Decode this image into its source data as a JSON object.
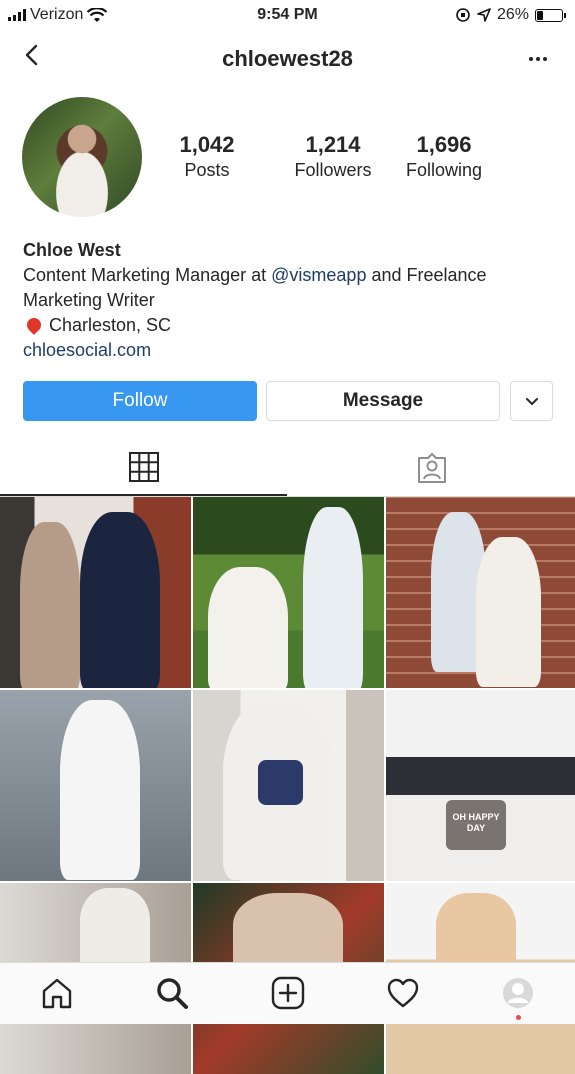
{
  "status_bar": {
    "carrier": "Verizon",
    "time": "9:54 PM",
    "battery": "26%",
    "battery_level": 0.26
  },
  "header": {
    "username": "chloewest28",
    "back_icon": "chevron-left-icon",
    "more_icon": "more-dots-icon"
  },
  "profile": {
    "stats": [
      {
        "value": "1,042",
        "label": "Posts"
      },
      {
        "value": "1,214",
        "label": "Followers"
      },
      {
        "value": "1,696",
        "label": "Following"
      }
    ],
    "name": "Chloe West",
    "bio_prefix": "Content Marketing Manager at ",
    "bio_mention": "@vismeapp",
    "bio_suffix": " and Freelance Marketing Writer",
    "location": "Charleston, SC",
    "website": "chloesocial.com"
  },
  "actions": {
    "follow_label": "Follow",
    "message_label": "Message"
  },
  "tabs": [
    {
      "icon": "grid-icon",
      "active": true
    },
    {
      "icon": "tagged-user-icon",
      "active": false
    }
  ],
  "grid_text": {
    "pillow": "OH HAPPY DAY"
  },
  "bottom_nav": [
    "home-icon",
    "search-icon",
    "add-post-icon",
    "activity-heart-icon",
    "profile-avatar-icon"
  ],
  "colors": {
    "accent": "#3897f0",
    "link": "#1f3c6a",
    "notification_dot": "#ed4956"
  }
}
